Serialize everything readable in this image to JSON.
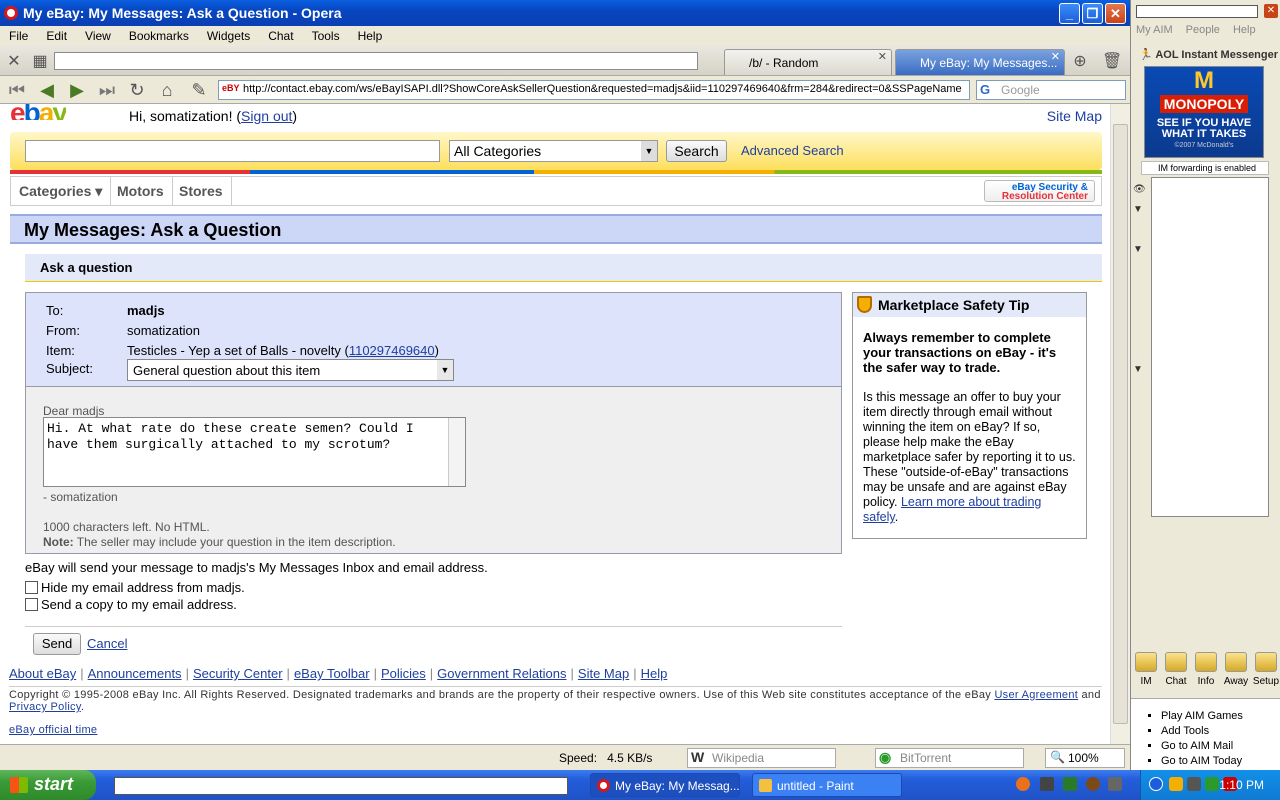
{
  "window": {
    "title": "My eBay: My Messages: Ask a Question - Opera"
  },
  "menu": [
    "File",
    "Edit",
    "View",
    "Bookmarks",
    "Widgets",
    "Chat",
    "Tools",
    "Help"
  ],
  "tabs": [
    {
      "label": "/b/ - Random"
    },
    {
      "label": "My eBay: My Messages..."
    }
  ],
  "address": {
    "url": "http://contact.ebay.com/ws/eBayISAPI.dll?ShowCoreAskSellerQuestion&requested=madjs&iid=110297469640&frm=284&redirect=0&SSPageName",
    "search_placeholder": "Google"
  },
  "header": {
    "greeting": "Hi, somatization! (",
    "sign_out": "Sign out",
    "greeting_end": ")",
    "site_map": "Site Map"
  },
  "searchbar": {
    "category": "All Categories",
    "search_label": "Search",
    "advanced": "Advanced Search"
  },
  "catbar": {
    "categories": "Categories ▾",
    "motors": "Motors",
    "stores": "Stores",
    "security_line1": "eBay Security &",
    "security_line2": "Resolution Center"
  },
  "page": {
    "title": "My Messages: Ask a Question",
    "subtitle": "Ask a question"
  },
  "form": {
    "to_label": "To:",
    "to_value": "madjs",
    "from_label": "From:",
    "from_value": "somatization",
    "item_label": "Item:",
    "item_value": "Testicles - Yep a set of Balls - novelty (",
    "item_id": "110297469640",
    "item_end": ")",
    "subject_label": "Subject:",
    "subject_value": "General question about this item",
    "dear": "Dear madjs",
    "message": "Hi. At what rate do these create semen? Could I have them surgically attached to my scrotum?",
    "signature": "- somatization",
    "chars_left": "1000 characters left. No HTML.",
    "note_label": "Note:",
    "note_text": " The seller may include your question in the item description."
  },
  "send_info": "eBay will send your message to madjs's My Messages Inbox and email address.",
  "checkboxes": {
    "hide": "Hide my email address from madjs.",
    "copy": "Send a copy to my email address."
  },
  "buttons": {
    "send": "Send",
    "cancel": "Cancel"
  },
  "tip": {
    "title": "Marketplace Safety Tip",
    "bold": "Always remember to complete your transactions on eBay - it's the safer way to trade.",
    "text": "Is this message an offer to buy your item directly through email without winning the item on eBay? If so, please help make the eBay marketplace safer by reporting it to us. These \"outside-of-eBay\" transactions may be unsafe and are against eBay policy. ",
    "link": "Learn more about trading safely",
    "end": "."
  },
  "footer": {
    "links": [
      "About eBay",
      "Announcements",
      "Security Center",
      "eBay Toolbar",
      "Policies",
      "Government Relations",
      "Site Map",
      "Help"
    ],
    "copyright": "Copyright © 1995-2008 eBay Inc. All Rights Reserved. Designated trademarks and brands are the property of their respective owners. Use of this Web site constitutes acceptance of the eBay ",
    "user_agreement": "User Agreement",
    "and": " and ",
    "privacy": "Privacy Policy",
    "period": ".",
    "official_time": "eBay official time"
  },
  "status": {
    "speed_label": "Speed:",
    "speed_value": "4.5 KB/s",
    "wikipedia": "Wikipedia",
    "bittorrent": "BitTorrent",
    "zoom": "100%"
  },
  "aim": {
    "menu": [
      "My AIM",
      "People",
      "Help"
    ],
    "title": "AOL Instant Messenger",
    "ad_brand": "M",
    "ad_title": "MONOPOLY",
    "ad_line": "SEE IF YOU HAVE WHAT IT TAKES",
    "ad_small": "©2007 McDonald's",
    "im_forwarding": "IM forwarding is enabled",
    "tools": [
      "IM",
      "Chat",
      "Info",
      "Away",
      "Setup"
    ],
    "links": [
      "Play AIM Games",
      "Add Tools",
      "Go to AIM Mail",
      "Go to AIM Today"
    ]
  },
  "taskbar": {
    "start": "start",
    "tasks": [
      "My eBay: My Messag...",
      "untitled - Paint"
    ],
    "clock": "1:10 PM"
  }
}
